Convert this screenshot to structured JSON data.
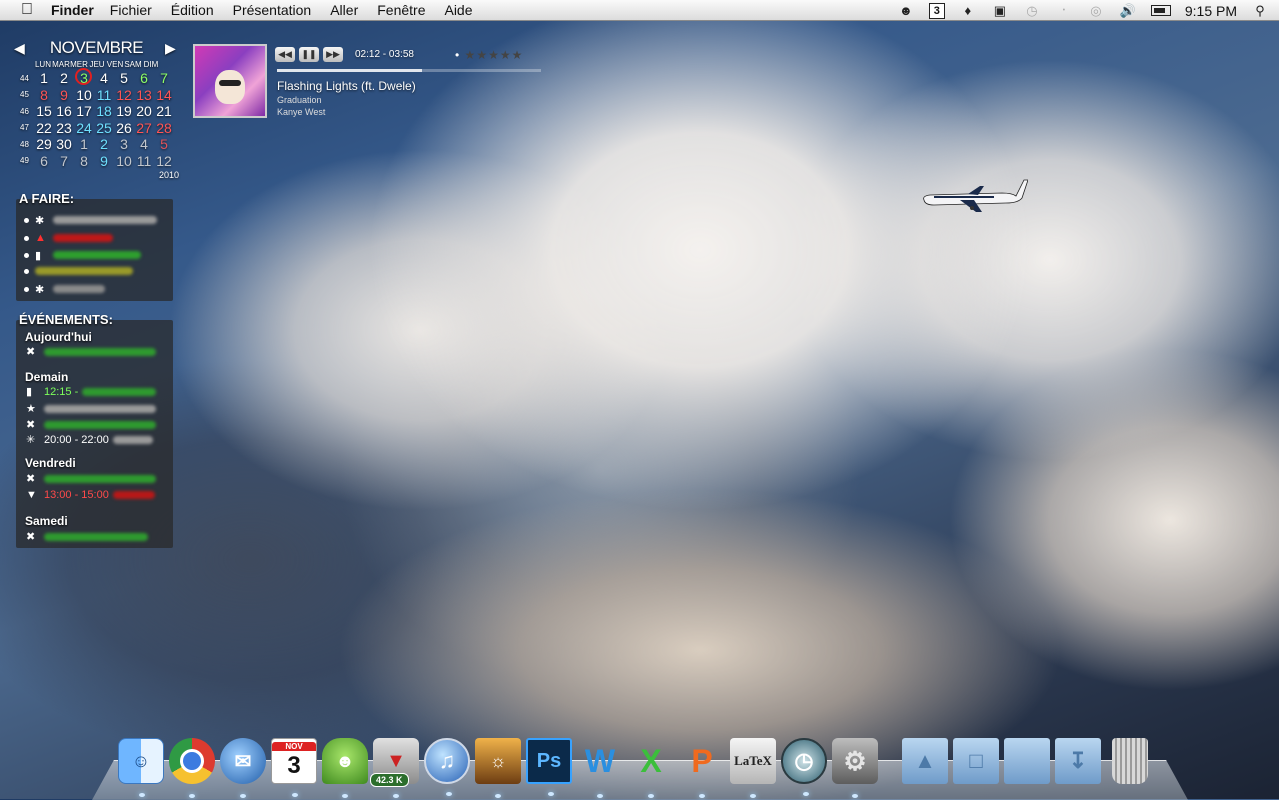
{
  "menubar": {
    "app": "Finder",
    "items": [
      "Fichier",
      "Édition",
      "Présentation",
      "Aller",
      "Fenêtre",
      "Aide"
    ],
    "calendar_badge": "3",
    "clock": "9:15 PM"
  },
  "calendar": {
    "month": "NOVEMBRE",
    "year": "2010",
    "weekdays": [
      "LUN",
      "MAR",
      "MER",
      "JEU",
      "VEN",
      "SAM",
      "DIM"
    ],
    "weeks": [
      {
        "week": "44",
        "days": [
          "1",
          "2",
          "3",
          "4",
          "5",
          "6",
          "7"
        ]
      },
      {
        "week": "45",
        "days": [
          "8",
          "9",
          "10",
          "11",
          "12",
          "13",
          "14"
        ]
      },
      {
        "week": "46",
        "days": [
          "15",
          "16",
          "17",
          "18",
          "19",
          "20",
          "21"
        ]
      },
      {
        "week": "47",
        "days": [
          "22",
          "23",
          "24",
          "25",
          "26",
          "27",
          "28"
        ]
      },
      {
        "week": "48",
        "days": [
          "29",
          "30",
          "1",
          "2",
          "3",
          "4",
          "5"
        ]
      },
      {
        "week": "49",
        "days": [
          "6",
          "7",
          "8",
          "9",
          "10",
          "11",
          "12"
        ]
      }
    ]
  },
  "music": {
    "time": "02:12 - 03:58",
    "track": "Flashing Lights (ft. Dwele)",
    "album": "Graduation",
    "artist": "Kanye West",
    "progress": 0.55,
    "rating": 0
  },
  "todo": {
    "title": "A FAIRE:"
  },
  "events": {
    "title": "ÉVÉNEMENTS:",
    "groups": [
      {
        "label": "Aujourd'hui"
      },
      {
        "label": "Demain",
        "time1": "12:15 -",
        "time2": "20:00 - 22:00"
      },
      {
        "label": "Vendredi",
        "time1": "13:00 - 15:00"
      },
      {
        "label": "Samedi"
      }
    ]
  },
  "dock": {
    "items": [
      {
        "icon": "finder-icon"
      },
      {
        "icon": "chrome-icon"
      },
      {
        "icon": "mail-icon"
      },
      {
        "icon": "ical-icon",
        "label": "NOV",
        "day": "3"
      },
      {
        "icon": "adium-icon"
      },
      {
        "icon": "transmission-icon",
        "badge": "42.3 K"
      },
      {
        "icon": "itunes-icon"
      },
      {
        "icon": "iphoto-icon"
      },
      {
        "icon": "photoshop-icon",
        "label": "Ps"
      },
      {
        "icon": "word-icon",
        "label": "W"
      },
      {
        "icon": "excel-icon",
        "label": "X"
      },
      {
        "icon": "powerpoint-icon",
        "label": "P"
      },
      {
        "icon": "latex-icon",
        "label": "LaTeX"
      },
      {
        "icon": "time-machine-icon"
      },
      {
        "icon": "system-preferences-icon"
      },
      {
        "icon": "applications-folder-icon"
      },
      {
        "icon": "documents-folder-icon"
      },
      {
        "icon": "folder-icon"
      },
      {
        "icon": "downloads-folder-icon"
      },
      {
        "icon": "trash-icon"
      }
    ]
  },
  "colors": {
    "accent_red": "#e02020",
    "accent_green": "#7dff5a",
    "accent_cyan": "#6fe0ff"
  }
}
